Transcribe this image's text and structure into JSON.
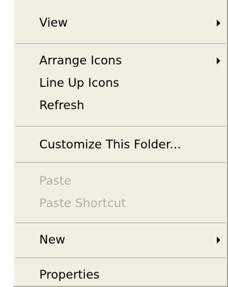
{
  "context_menu": {
    "items": [
      {
        "label": "View",
        "has_submenu": true,
        "enabled": true
      },
      {
        "label": "Arrange Icons",
        "has_submenu": true,
        "enabled": true
      },
      {
        "label": "Line Up Icons",
        "has_submenu": false,
        "enabled": true
      },
      {
        "label": "Refresh",
        "has_submenu": false,
        "enabled": true
      },
      {
        "label": "Customize This Folder...",
        "has_submenu": false,
        "enabled": true
      },
      {
        "label": "Paste",
        "has_submenu": false,
        "enabled": false
      },
      {
        "label": "Paste Shortcut",
        "has_submenu": false,
        "enabled": false
      },
      {
        "label": "New",
        "has_submenu": true,
        "enabled": true
      },
      {
        "label": "Properties",
        "has_submenu": false,
        "enabled": true
      }
    ],
    "icons": {
      "submenu_arrow": "submenu-arrow-icon"
    },
    "colors": {
      "background": "#f1efe2",
      "separator_dark": "#aca899",
      "disabled_text": "#aca899"
    }
  }
}
